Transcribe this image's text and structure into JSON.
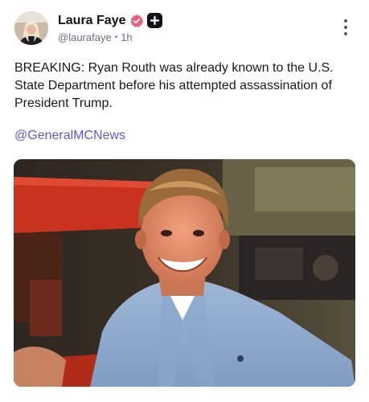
{
  "author": {
    "display_name": "Laura Faye",
    "handle": "@laurafaye",
    "separator": "•",
    "time": "1h",
    "avatar_icon": "profile-photo",
    "verified_badge_color": "#ec5b7a",
    "plus_badge_color": "#0f1117"
  },
  "post": {
    "text": "BREAKING: Ryan Routh was already known to the U.S. State Department before his attempted assassination of President Trump.",
    "mention": "@GeneralMCNews",
    "mention_color": "#5b5bd6",
    "media_icon": "photo-smiling-man-blue-shirt"
  },
  "menu": {
    "icon": "more-vertical-icon"
  }
}
